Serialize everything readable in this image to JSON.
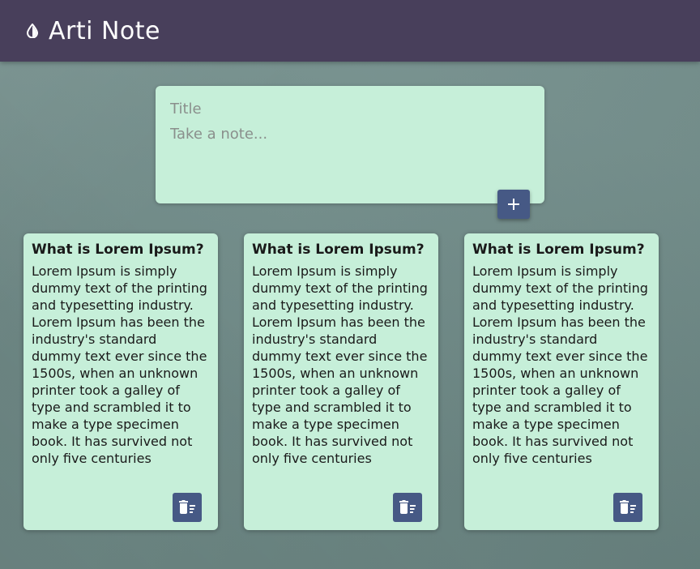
{
  "header": {
    "title": "Arti Note",
    "logo_icon": "drop-half-icon",
    "background_color": "#483f5b"
  },
  "composer": {
    "title_placeholder": "Title",
    "content_placeholder": "Take a note...",
    "add_button_icon": "plus-icon",
    "add_button_symbol": "+"
  },
  "notes": [
    {
      "title": "What is Lorem Ipsum?",
      "content": "Lorem Ipsum is simply dummy text of the printing and typesetting industry. Lorem Ipsum has been the industry's standard dummy text ever since the 1500s, when an unknown printer took a galley of type and scrambled it to make a type specimen book. It has survived not only five centuries",
      "delete_icon": "delete-sweep-icon"
    },
    {
      "title": "What is Lorem Ipsum?",
      "content": "Lorem Ipsum is simply dummy text of the printing and typesetting industry. Lorem Ipsum has been the industry's standard dummy text ever since the 1500s, when an unknown printer took a galley of type and scrambled it to make a type specimen book. It has survived not only five centuries",
      "delete_icon": "delete-sweep-icon"
    },
    {
      "title": "What is Lorem Ipsum?",
      "content": "Lorem Ipsum is simply dummy text of the printing and typesetting industry. Lorem Ipsum has been the industry's standard dummy text ever since the 1500s, when an unknown printer took a galley of type and scrambled it to make a type specimen book. It has survived not only five centuries",
      "delete_icon": "delete-sweep-icon"
    }
  ],
  "colors": {
    "note_background": "#c6efd9",
    "button_background": "#465985",
    "page_background": "#6f8b88"
  }
}
